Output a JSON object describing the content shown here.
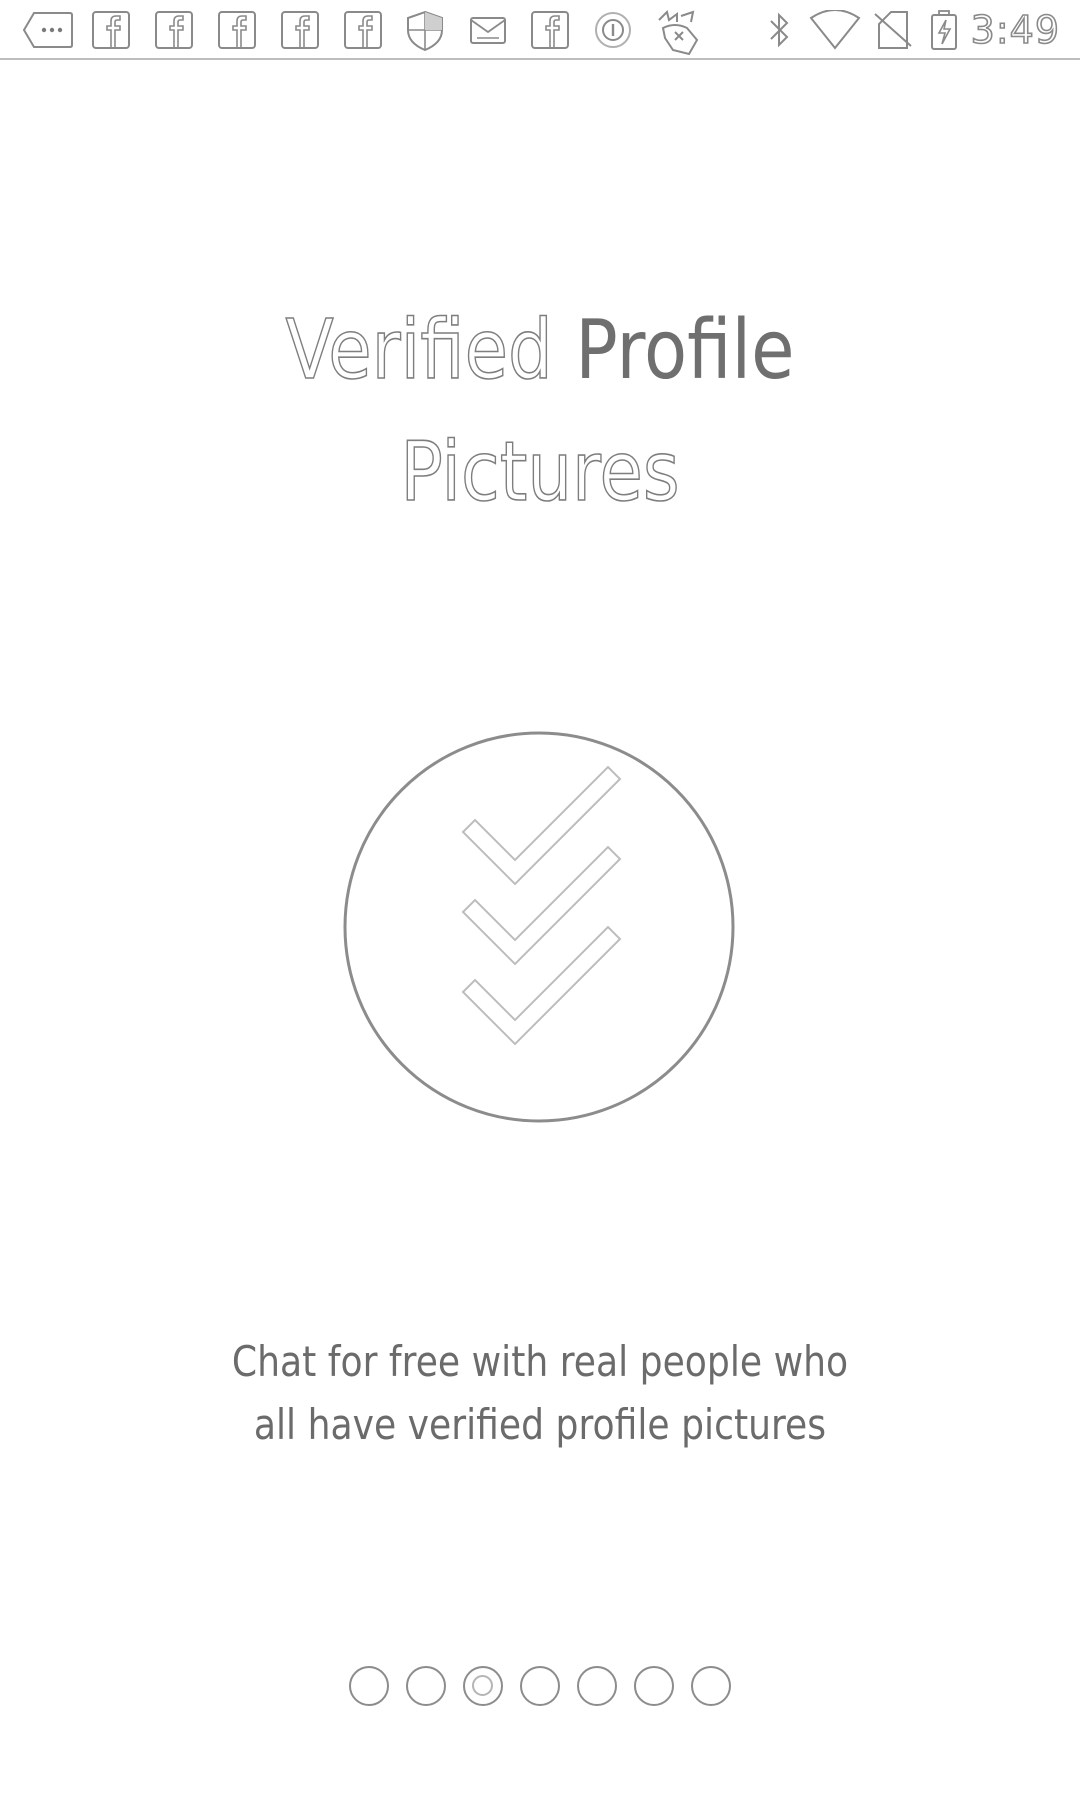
{
  "status_bar": {
    "time": "3:49",
    "notification_icons": [
      "overflow-dots-icon",
      "facebook-icon",
      "facebook-icon",
      "facebook-icon",
      "facebook-icon",
      "facebook-icon",
      "shield-icon",
      "mail-icon",
      "facebook-icon",
      "circle-badge-icon",
      "mascot-icon"
    ],
    "system_icons": [
      "bluetooth-icon",
      "wifi-icon",
      "no-sim-icon",
      "battery-charging-icon"
    ]
  },
  "onboarding": {
    "title_line1_word1": "Verified",
    "title_line1_word2": "Profile",
    "title_line2": "Pictures",
    "badge_icon": "triple-checkmark-icon",
    "description_line1": "Chat for free with real people who",
    "description_line2": "all have verified profile pictures"
  },
  "pager": {
    "total_pages": 7,
    "current_page": 3
  },
  "colors": {
    "background": "#ffffff",
    "outline_gray": "#8c8c8c",
    "text_gray": "#6b6b6b"
  }
}
